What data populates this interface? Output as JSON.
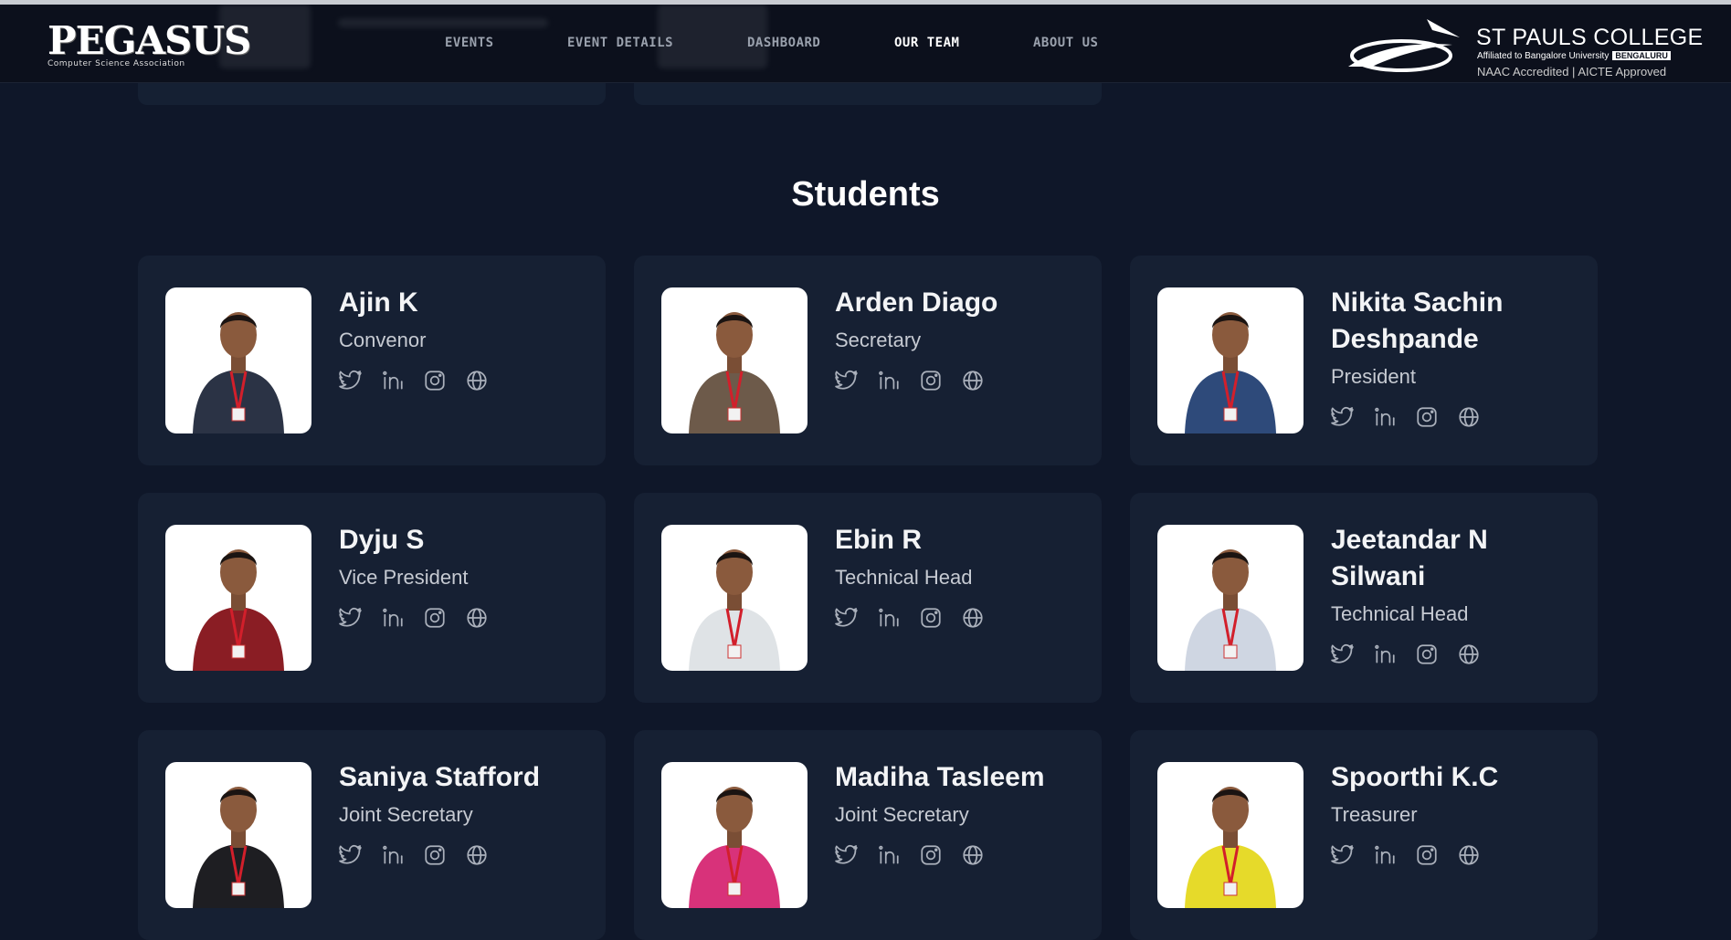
{
  "brand": {
    "name": "PEGASUS",
    "tagline": "Computer Science Association"
  },
  "nav": [
    "EVENTS",
    "EVENT DETAILS",
    "DASHBOARD",
    "OUR TEAM",
    "ABOUT US"
  ],
  "active_nav": "OUR TEAM",
  "college": {
    "name": "ST PAULS COLLEGE",
    "affiliation": "Affiliated to Bangalore University",
    "city": "BENGALURU",
    "accreditation": "NAAC Accredited | AICTE Approved"
  },
  "section_title": "Students",
  "members": [
    {
      "name": "Ajin K",
      "role": "Convenor",
      "shirt": "#2b3345"
    },
    {
      "name": "Arden Diago",
      "role": "Secretary",
      "shirt": "#6d5a4a"
    },
    {
      "name": "Nikita Sachin Deshpande",
      "role": "President",
      "shirt": "#2e4a7a"
    },
    {
      "name": "Dyju S",
      "role": "Vice President",
      "shirt": "#8a1d24"
    },
    {
      "name": "Ebin R",
      "role": "Technical Head",
      "shirt": "#dfe3e6"
    },
    {
      "name": "Jeetandar N Silwani",
      "role": "Technical Head",
      "shirt": "#cfd6e2"
    },
    {
      "name": "Saniya Stafford",
      "role": "Joint Secretary",
      "shirt": "#1e1e22"
    },
    {
      "name": "Madiha Tasleem",
      "role": "Joint Secretary",
      "shirt": "#d8327a"
    },
    {
      "name": "Spoorthi K.C",
      "role": "Treasurer",
      "shirt": "#e6da2a"
    }
  ],
  "social_icons": [
    "twitter-icon",
    "linkedin-icon",
    "instagram-icon",
    "globe-icon"
  ],
  "colors": {
    "background": "#0f1729",
    "card": "#162033",
    "header": "#0c101c"
  }
}
